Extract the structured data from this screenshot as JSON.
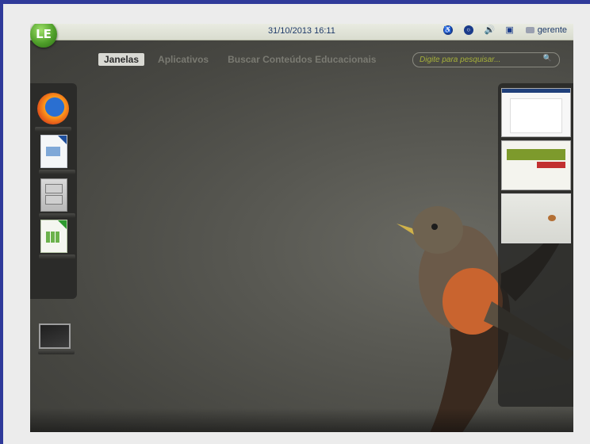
{
  "topbar": {
    "clock": "31/10/2013 16:11",
    "tray": [
      {
        "icon": "accessibility-icon"
      },
      {
        "icon": "help-icon"
      },
      {
        "icon": "volume-icon"
      },
      {
        "icon": "network-icon"
      }
    ],
    "user_name": "gerente"
  },
  "tabs": [
    {
      "label": "Janelas",
      "active": true
    },
    {
      "label": "Aplicativos",
      "active": false
    },
    {
      "label": "Buscar Conteúdos Educacionais",
      "active": false
    }
  ],
  "search": {
    "placeholder": "Digite para pesquisar..."
  },
  "dock": [
    {
      "icon": "firefox-icon"
    },
    {
      "icon": "libreoffice-writer-icon"
    },
    {
      "icon": "file-manager-icon"
    },
    {
      "icon": "libreoffice-calc-icon"
    },
    {
      "icon": "terminal-icon"
    }
  ],
  "colors": {
    "accent": "#b8c13a",
    "topbar_text": "#1e3a6a",
    "logo_green": "#4f9f2a"
  }
}
